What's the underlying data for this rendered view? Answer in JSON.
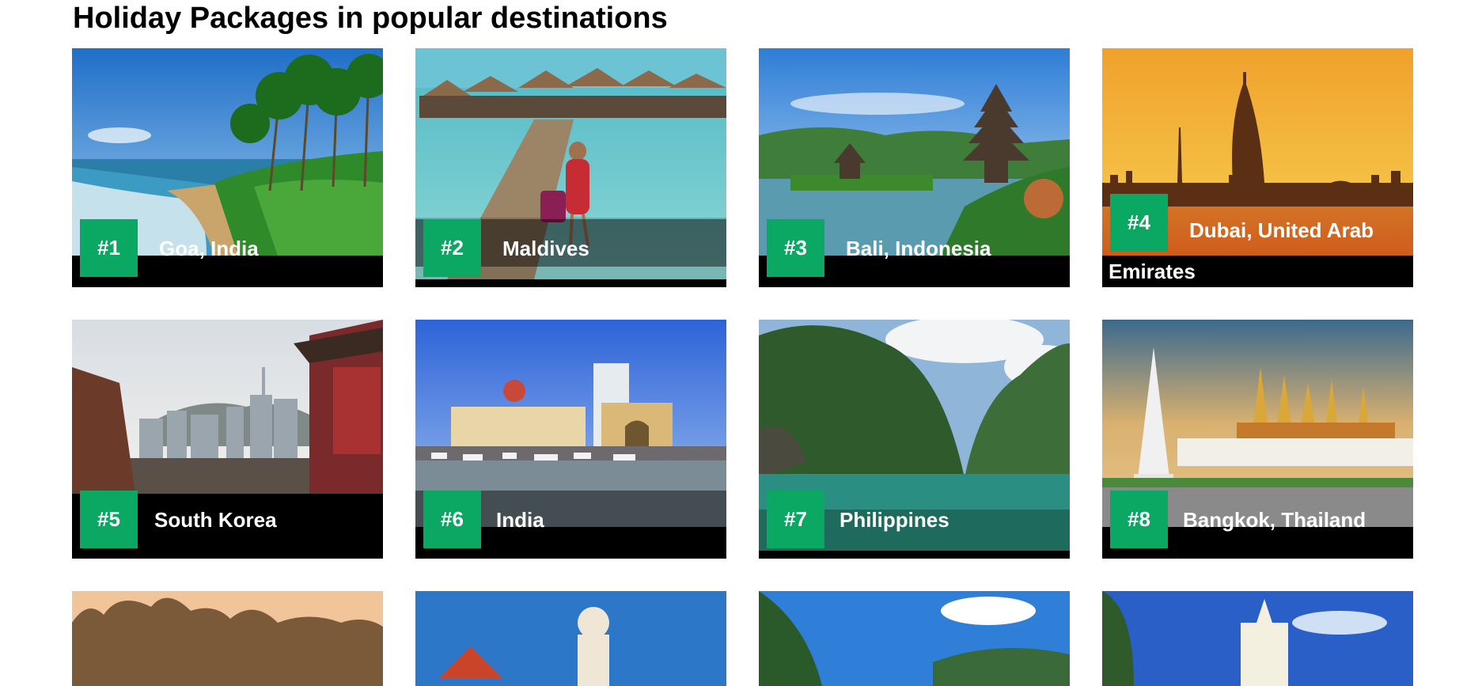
{
  "page": {
    "title": "Holiday Packages in popular destinations"
  },
  "destinations": [
    {
      "rank": "#1",
      "name": "Goa, India"
    },
    {
      "rank": "#2",
      "name": "Maldives"
    },
    {
      "rank": "#3",
      "name": "Bali, Indonesia"
    },
    {
      "rank": "#4",
      "name": "Dubai, United Arab Emirates"
    },
    {
      "rank": "#5",
      "name": "South Korea"
    },
    {
      "rank": "#6",
      "name": "India"
    },
    {
      "rank": "#7",
      "name": "Philippines"
    },
    {
      "rank": "#8",
      "name": "Bangkok, Thailand"
    }
  ],
  "colors": {
    "rank_badge": "#0aa863",
    "card_footer": "#000000",
    "text_on_card": "#ffffff"
  }
}
